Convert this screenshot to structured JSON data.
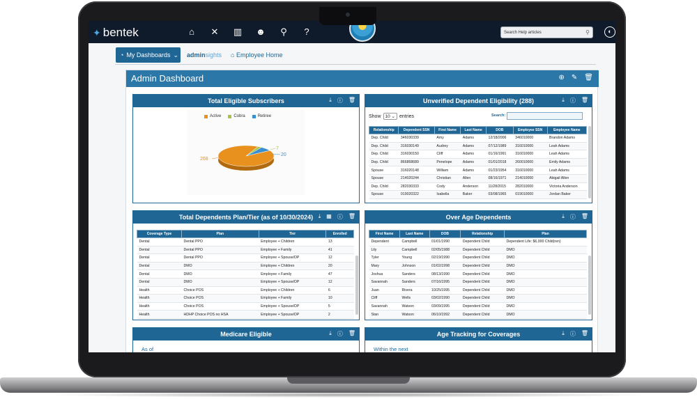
{
  "app": {
    "logo": "bentek",
    "nav_icons": [
      "home-icon",
      "tools-icon",
      "building-icon",
      "users-icon",
      "search-icon",
      "help-icon"
    ],
    "help_search_placeholder": "Search Help articles"
  },
  "subnav": {
    "my_dashboards": "My Dashboards",
    "adminsights_a": "admin",
    "adminsights_b": "sights",
    "employee_home": "Employee Home"
  },
  "dashboard": {
    "title": "Admin Dashboard"
  },
  "widgets": {
    "subscribers": {
      "title": "Total Eligible Subscribers",
      "legend": [
        "Active",
        "Cobra",
        "Retiree"
      ],
      "label_active": "268",
      "label_cobra": "7",
      "label_retiree": "20"
    },
    "unverified": {
      "title": "Unverified Dependent Eligibility (288)",
      "show": "Show",
      "entries_value": "10",
      "entries": "entries",
      "search": "Search:",
      "columns": [
        "Relationship",
        "Dependent SSN",
        "First Name",
        "Last Name",
        "DOB",
        "Employee SSN",
        "Employee Name"
      ],
      "rows": [
        [
          "Dep. Child",
          "346030339",
          "Amy",
          "Adams",
          "12/18/2006",
          "346010000",
          "Brandon Adams"
        ],
        [
          "Dep. Child",
          "316030149",
          "Audrey",
          "Adams",
          "07/12/1989",
          "316010000",
          "Leah Adams"
        ],
        [
          "Dep. Child",
          "316030150",
          "Cliff",
          "Adams",
          "01/16/1991",
          "316010000",
          "Leah Adams"
        ],
        [
          "Dep. Child",
          "866868689",
          "Penelope",
          "Adams",
          "01/01/2018",
          "260010000",
          "Emily Adams"
        ],
        [
          "Spouse",
          "316020148",
          "William",
          "Adams",
          "01/23/1954",
          "316010000",
          "Leah Adams"
        ],
        [
          "Spouse",
          "214020244",
          "Christian",
          "Allen",
          "08/16/1971",
          "214010000",
          "Abigail Allen"
        ],
        [
          "Dep. Child",
          "282030333",
          "Cody",
          "Anderson",
          "11/28/2015",
          "282010000",
          "Victoria Anderson"
        ],
        [
          "Spouse",
          "019020322",
          "Isabella",
          "Baker",
          "03/08/1965",
          "019010000",
          "Jordan Baker"
        ]
      ]
    },
    "plan_tier": {
      "title": "Total Dependents Plan/Tier (as of 10/30/2024)",
      "columns": [
        "Coverage Type",
        "Plan",
        "Tier",
        "Enrolled"
      ],
      "rows": [
        [
          "Dental",
          "Dental PPO",
          "Employee + Children",
          "13"
        ],
        [
          "Dental",
          "Dental PPO",
          "Employee + Family",
          "41"
        ],
        [
          "Dental",
          "Dental PPO",
          "Employee + Spouse/DP",
          "12"
        ],
        [
          "Dental",
          "DMO",
          "Employee + Children",
          "20"
        ],
        [
          "Dental",
          "DMO",
          "Employee + Family",
          "47"
        ],
        [
          "Dental",
          "DMO",
          "Employee + Spouse/DP",
          "12"
        ],
        [
          "Health",
          "Choice POS",
          "Employee + Children",
          "6"
        ],
        [
          "Health",
          "Choice POS",
          "Employee + Family",
          "10"
        ],
        [
          "Health",
          "Choice POS",
          "Employee + Spouse/DP",
          "5"
        ],
        [
          "Health",
          "HDHP Choice POS no HSA",
          "Employee + Spouse/DP",
          "2"
        ]
      ]
    },
    "over_age": {
      "title": "Over Age Dependents",
      "columns": [
        "First Name",
        "Last Name",
        "DOB",
        "Relationship",
        "Plan"
      ],
      "rows": [
        [
          "Dependent",
          "Campbell",
          "01/01/1990",
          "Dependent Child",
          "Dependent Life: $6,000 Child(ren)"
        ],
        [
          "Lily",
          "Campbell",
          "02/05/1988",
          "Dependent Child",
          "DMO"
        ],
        [
          "Tyler",
          "Young",
          "02/19/1990",
          "Dependent Child",
          "DMO"
        ],
        [
          "Mary",
          "Johnson",
          "01/02/1998",
          "Dependent Child",
          "DMO"
        ],
        [
          "Joshua",
          "Sanders",
          "08/13/1990",
          "Dependent Child",
          "DMO"
        ],
        [
          "Savannah",
          "Sanders",
          "07/16/1995",
          "Dependent Child",
          "DMO"
        ],
        [
          "Juan",
          "Rivera",
          "10/25/1995",
          "Dependent Child",
          "DMO"
        ],
        [
          "Cliff",
          "Wells",
          "03/02/1990",
          "Dependent Child",
          "DMO"
        ],
        [
          "Savannah",
          "Watson",
          "03/09/1995",
          "Dependent Child",
          "DMO"
        ],
        [
          "Stan",
          "Watson",
          "06/10/1992",
          "Dependent Child",
          "DMO"
        ]
      ]
    },
    "medicare": {
      "title": "Medicare Eligible",
      "as_of": "As of"
    },
    "age_tracking": {
      "title": "Age Tracking for Coverages",
      "within": "Within the next"
    }
  },
  "chart_data": {
    "type": "pie",
    "categories": [
      "Active",
      "Cobra",
      "Retiree"
    ],
    "values": [
      268,
      7,
      20
    ],
    "colors": [
      "#e8911f",
      "#a6c44a",
      "#3a8fd0"
    ],
    "title": "Total Eligible Subscribers"
  },
  "colors": {
    "primary": "#1f6695",
    "admin_header": "#2a77a8",
    "nav": "#0f1a2a"
  }
}
